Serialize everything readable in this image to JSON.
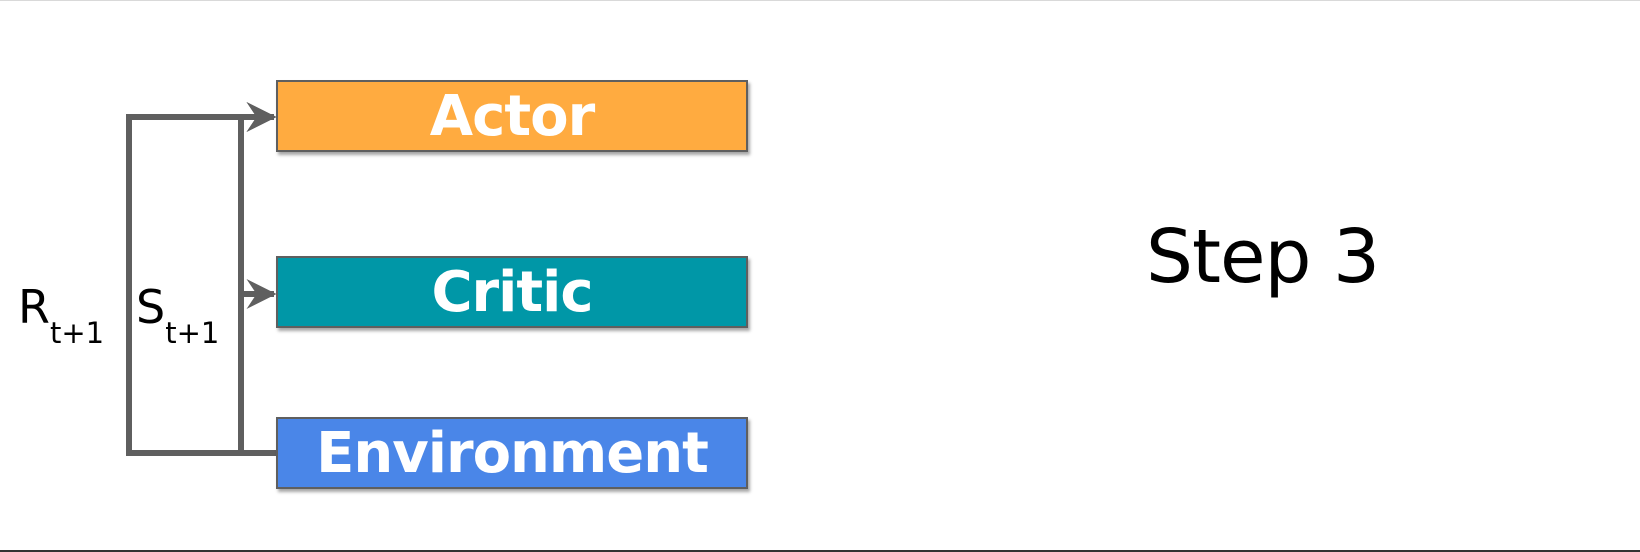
{
  "blocks": {
    "actor": {
      "label": "Actor",
      "color": "#ffab40"
    },
    "critic": {
      "label": "Critic",
      "color": "#0097a7"
    },
    "environment": {
      "label": "Environment",
      "color": "#4a86e8"
    }
  },
  "signals": {
    "reward": {
      "symbol": "R",
      "subscript": "t+1"
    },
    "state": {
      "symbol": "S",
      "subscript": "t+1"
    }
  },
  "step_label": "Step 3",
  "arrow_color": "#5f5f5f"
}
